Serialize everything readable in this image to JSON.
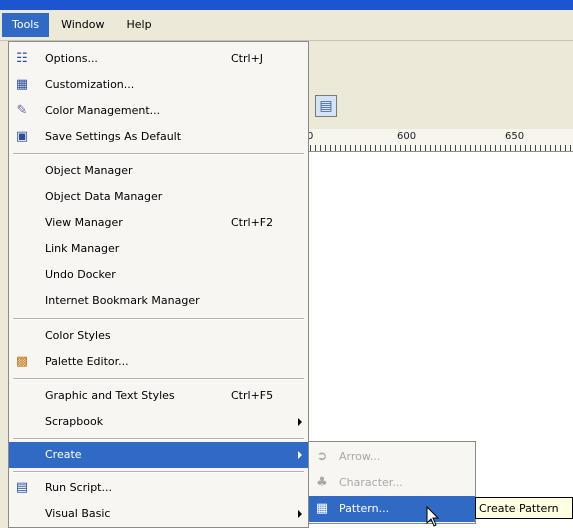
{
  "menubar": {
    "items": [
      {
        "label": "Tools",
        "active": true
      },
      {
        "label": "Window",
        "active": false
      },
      {
        "label": "Help",
        "active": false
      }
    ]
  },
  "ruler": {
    "labels": [
      "0",
      "600",
      "650"
    ]
  },
  "toolbar": {
    "icon": "layout-icon"
  },
  "tools_menu": {
    "items": [
      {
        "label": "Options...",
        "shortcut": "Ctrl+J",
        "icon": "options-icon"
      },
      {
        "label": "Customization...",
        "shortcut": "",
        "icon": "customization-icon"
      },
      {
        "label": "Color Management...",
        "shortcut": "",
        "icon": "color-management-icon"
      },
      {
        "label": "Save Settings As Default",
        "shortcut": "",
        "icon": "save-settings-icon"
      },
      {
        "label": "Object Manager",
        "shortcut": ""
      },
      {
        "label": "Object Data Manager",
        "shortcut": ""
      },
      {
        "label": "View Manager",
        "shortcut": "Ctrl+F2"
      },
      {
        "label": "Link Manager",
        "shortcut": ""
      },
      {
        "label": "Undo Docker",
        "shortcut": ""
      },
      {
        "label": "Internet Bookmark Manager",
        "shortcut": ""
      },
      {
        "label": "Color Styles",
        "shortcut": ""
      },
      {
        "label": "Palette Editor...",
        "shortcut": "",
        "icon": "palette-editor-icon"
      },
      {
        "label": "Graphic and Text Styles",
        "shortcut": "Ctrl+F5"
      },
      {
        "label": "Scrapbook",
        "shortcut": "",
        "submenu": true
      },
      {
        "label": "Create",
        "shortcut": "",
        "submenu": true,
        "highlighted": true
      },
      {
        "label": "Run Script...",
        "shortcut": "",
        "icon": "run-script-icon"
      },
      {
        "label": "Visual Basic",
        "shortcut": "",
        "submenu": true
      }
    ]
  },
  "create_submenu": {
    "items": [
      {
        "label": "Arrow...",
        "enabled": false,
        "icon": "arrow-icon"
      },
      {
        "label": "Character...",
        "enabled": false,
        "icon": "character-icon"
      },
      {
        "label": "Pattern...",
        "enabled": true,
        "highlighted": true,
        "icon": "pattern-icon"
      }
    ]
  },
  "tooltip": {
    "text": "Create Pattern"
  },
  "colors": {
    "highlight": "#316ac5",
    "menu_bg": "#f7f6f2",
    "menubar_bg": "#ece9d8",
    "title_blue": "#1d54cf",
    "tooltip_bg": "#ffffe1"
  }
}
